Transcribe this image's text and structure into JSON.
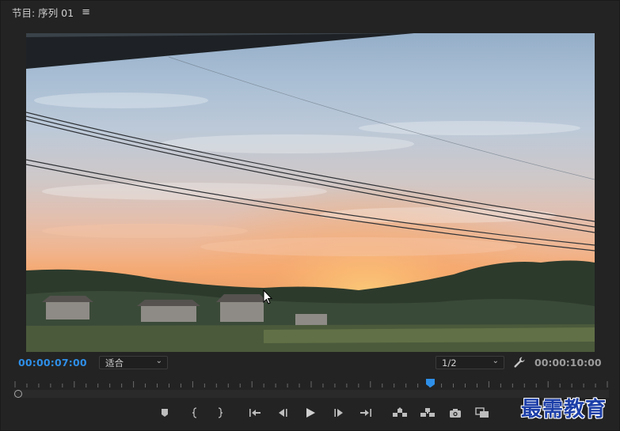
{
  "panel": {
    "title": "节目: 序列 01",
    "menu_glyph": "≡"
  },
  "viewer": {
    "content": "sunset-landscape-frame"
  },
  "controls": {
    "current_timecode": "00:00:07:00",
    "zoom_value": "适合",
    "resolution_value": "1/2",
    "duration_timecode": "00:00:10:00"
  },
  "playback": {
    "position_fraction": 0.7
  },
  "transport_buttons": [
    {
      "name": "add-marker-button",
      "icon": "marker-icon"
    },
    {
      "name": "mark-in-button",
      "icon": "mark-in-icon"
    },
    {
      "name": "mark-out-button",
      "icon": "mark-out-icon"
    },
    {
      "name": "go-to-in-button",
      "icon": "go-to-in-icon"
    },
    {
      "name": "step-back-button",
      "icon": "step-back-icon"
    },
    {
      "name": "play-button",
      "icon": "play-icon"
    },
    {
      "name": "step-forward-button",
      "icon": "step-forward-icon"
    },
    {
      "name": "go-to-out-button",
      "icon": "go-to-out-icon"
    },
    {
      "name": "lift-button",
      "icon": "lift-icon"
    },
    {
      "name": "extract-button",
      "icon": "extract-icon"
    },
    {
      "name": "export-frame-button",
      "icon": "camera-icon"
    },
    {
      "name": "comparison-view-button",
      "icon": "comparison-icon"
    }
  ],
  "watermark": {
    "text": "最需教育"
  },
  "colors": {
    "accent_timecode": "#2e8fe8",
    "playhead": "#2e8fe8",
    "panel_bg": "#232323"
  }
}
